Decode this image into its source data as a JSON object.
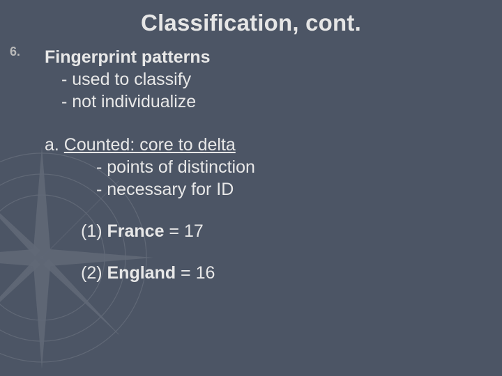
{
  "title": "Classification, cont.",
  "list_number": "6.",
  "heading": "Fingerprint patterns",
  "bullets1": {
    "a": "- used to classify",
    "b": "- not individualize"
  },
  "item_a": {
    "prefix": "a. ",
    "label": "Counted: core to delta",
    "sub1": "- points of distinction",
    "sub2": "- necessary for ID"
  },
  "france": {
    "num": "(1) ",
    "name": "France",
    "rest": " = 17"
  },
  "england": {
    "num": "(2) ",
    "name": "England",
    "rest": " = 16"
  }
}
